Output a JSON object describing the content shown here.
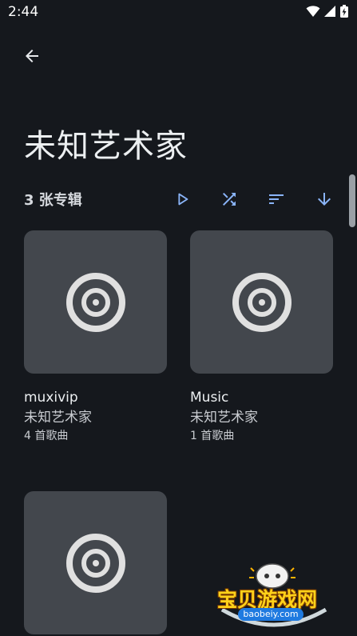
{
  "status_bar": {
    "time": "2:44"
  },
  "header": {
    "title": "未知艺术家"
  },
  "toolbar": {
    "album_count": "3 张专辑",
    "play_icon": "play-icon",
    "shuffle_icon": "shuffle-icon",
    "sort_icon": "sort-icon",
    "download_icon": "arrow-down-icon"
  },
  "albums": [
    {
      "name": "muxivip",
      "artist": "未知艺术家",
      "songs": "4 首歌曲"
    },
    {
      "name": "Music",
      "artist": "未知艺术家",
      "songs": "1 首歌曲"
    },
    {
      "name": "",
      "artist": "",
      "songs": ""
    }
  ],
  "watermark": {
    "text": "宝贝游戏网",
    "url": "baobeiy.com"
  },
  "colors": {
    "background": "#15181d",
    "accent": "#8ab4f8",
    "card": "#43474d"
  }
}
